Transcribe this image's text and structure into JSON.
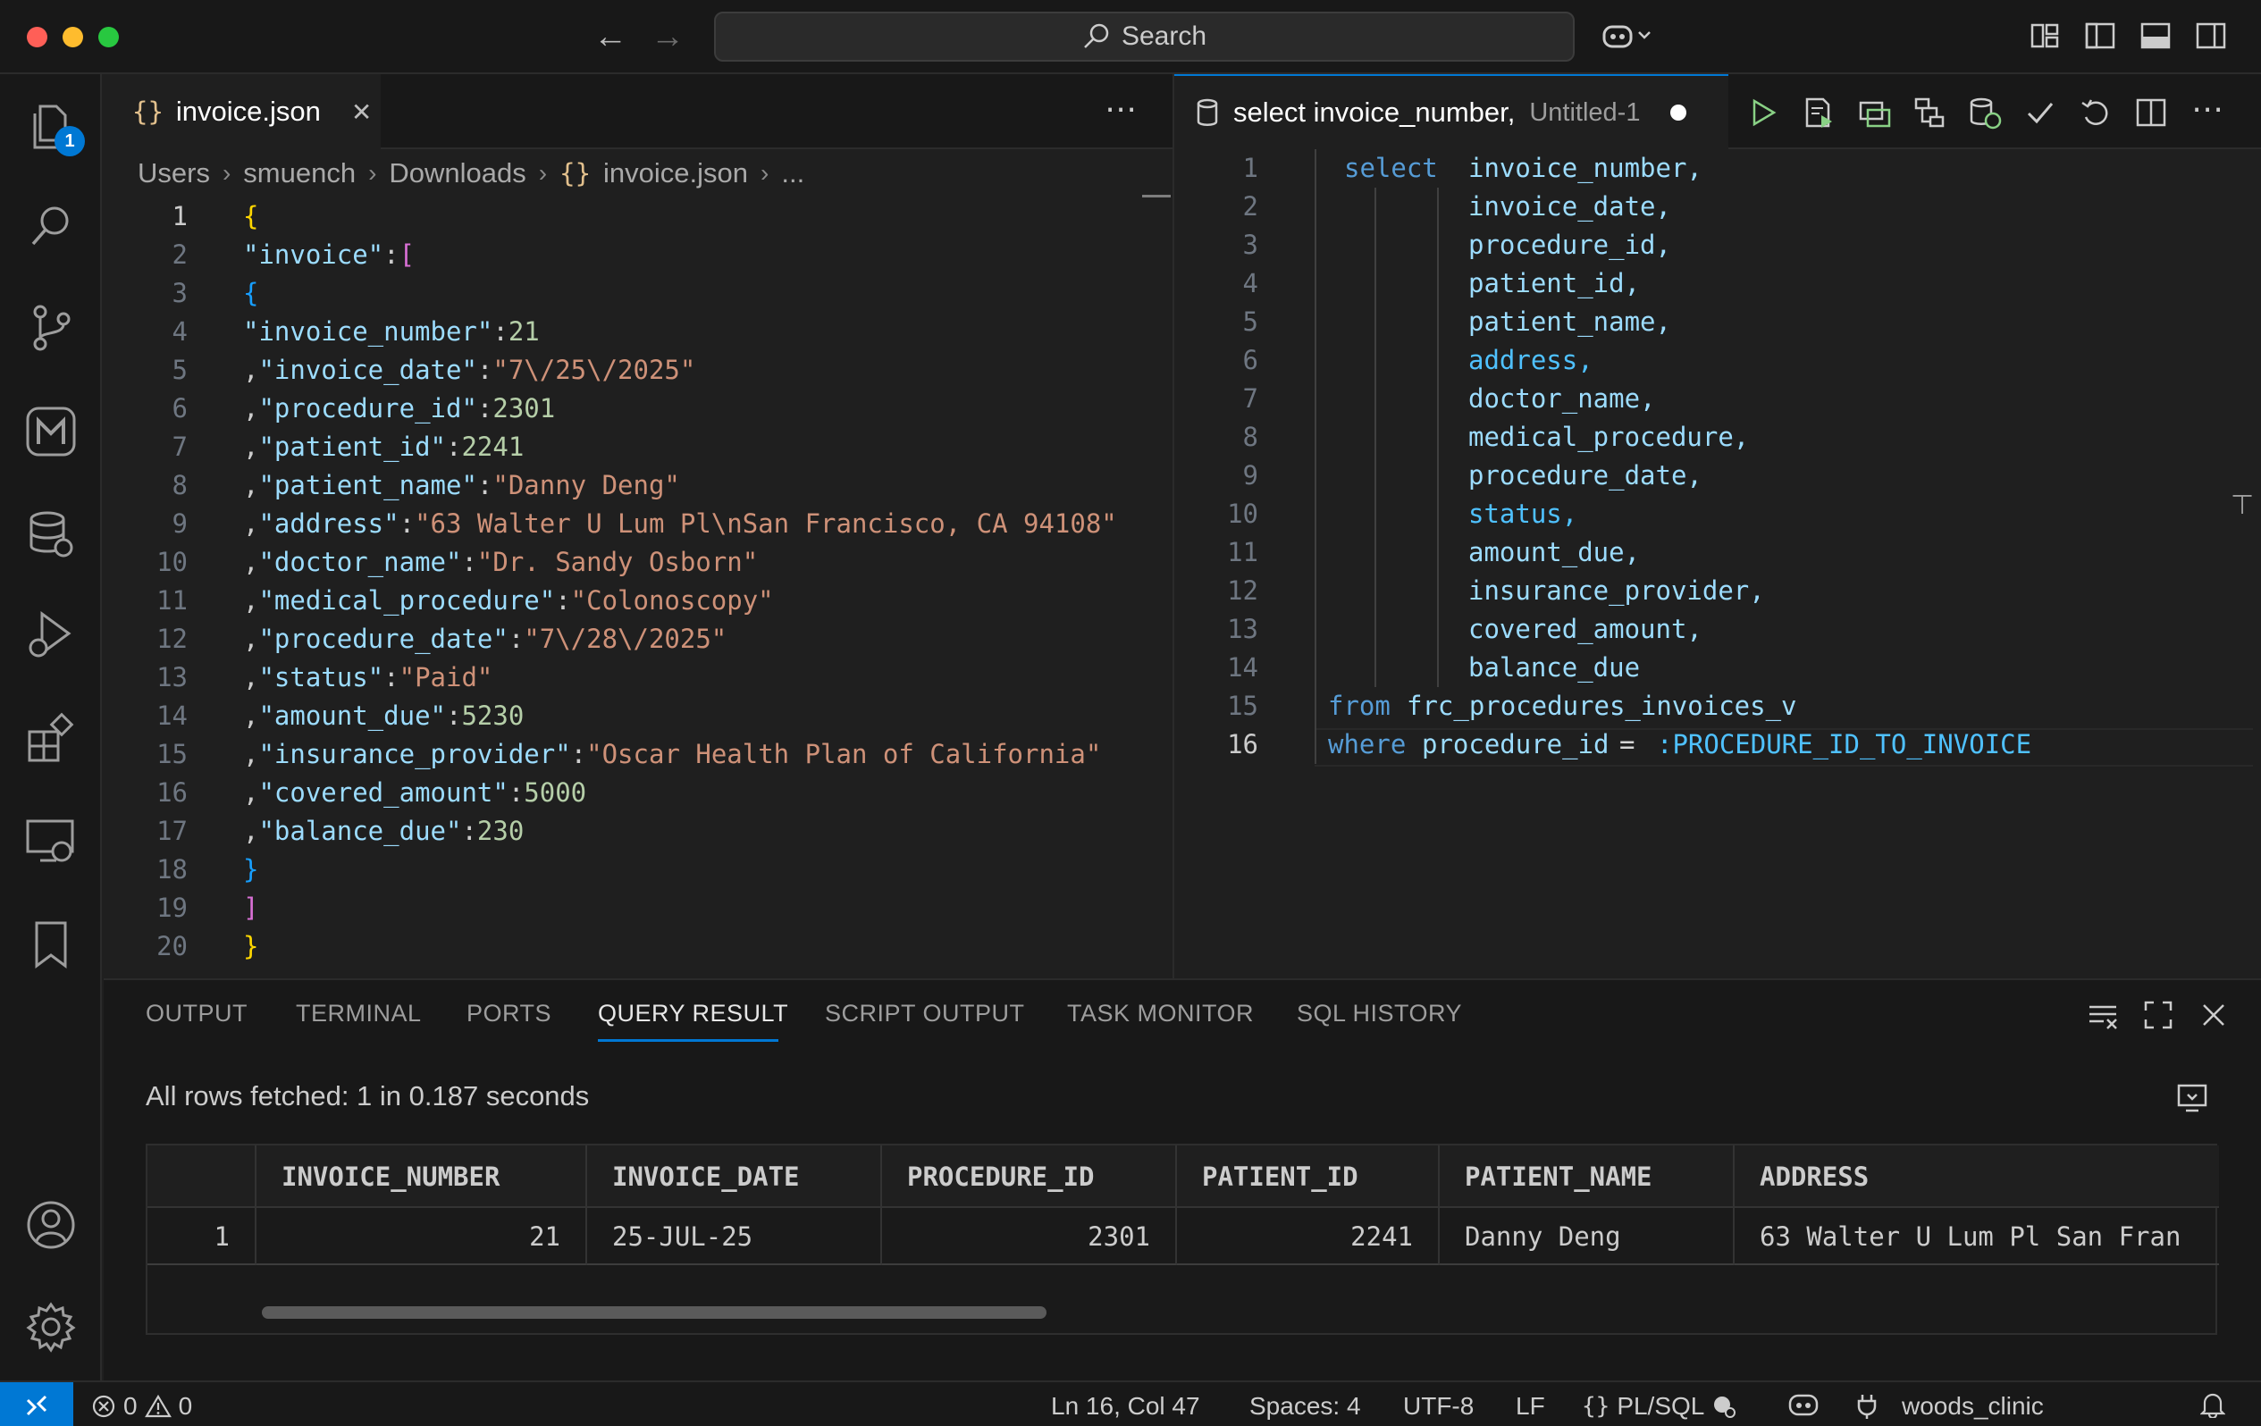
{
  "titlebar": {
    "search_label": "Search",
    "traffic_colors": [
      "#ff5f57",
      "#febc2e",
      "#28c840"
    ]
  },
  "activitybar": {
    "explorer_badge": "1",
    "icons": [
      "explorer-icon",
      "search-icon",
      "source-control-icon",
      "marketplace-m-icon",
      "database-icon",
      "run-debug-icon",
      "extensions-icon",
      "remote-explorer-icon",
      "bookmark-icon",
      "account-icon",
      "settings-gear-icon"
    ]
  },
  "left_editor": {
    "tab_label": "invoice.json",
    "breadcrumb": [
      "Users",
      "smuench",
      "Downloads",
      "invoice.json",
      "..."
    ],
    "line_numbers": [
      "1",
      "2",
      "3",
      "4",
      "5",
      "6",
      "7",
      "8",
      "9",
      "10",
      "11",
      "12",
      "13",
      "14",
      "15",
      "16",
      "17",
      "18",
      "19",
      "20"
    ],
    "json_lines": [
      {
        "open": "{"
      },
      {
        "key": "\"invoice\"",
        "open": "["
      },
      {
        "open": "{"
      },
      {
        "prefix": "",
        "key": "\"invoice_number\"",
        "num": "21"
      },
      {
        "prefix": ",",
        "key": "\"invoice_date\"",
        "str": "\"7\\/25\\/2025\""
      },
      {
        "prefix": ",",
        "key": "\"procedure_id\"",
        "num": "2301"
      },
      {
        "prefix": ",",
        "key": "\"patient_id\"",
        "num": "2241"
      },
      {
        "prefix": ",",
        "key": "\"patient_name\"",
        "str": "\"Danny Deng\""
      },
      {
        "prefix": ",",
        "key": "\"address\"",
        "str": "\"63 Walter U Lum Pl\\nSan Francisco, CA 94108\""
      },
      {
        "prefix": ",",
        "key": "\"doctor_name\"",
        "str": "\"Dr. Sandy Osborn\""
      },
      {
        "prefix": ",",
        "key": "\"medical_procedure\"",
        "str": "\"Colonoscopy\""
      },
      {
        "prefix": ",",
        "key": "\"procedure_date\"",
        "str": "\"7\\/28\\/2025\""
      },
      {
        "prefix": ",",
        "key": "\"status\"",
        "str": "\"Paid\""
      },
      {
        "prefix": ",",
        "key": "\"amount_due\"",
        "num": "5230"
      },
      {
        "prefix": ",",
        "key": "\"insurance_provider\"",
        "str": "\"Oscar Health Plan of California\""
      },
      {
        "prefix": ",",
        "key": "\"covered_amount\"",
        "num": "5000"
      },
      {
        "prefix": ",",
        "key": "\"balance_due\"",
        "num": "230"
      },
      {
        "close": "}"
      },
      {
        "close": "]"
      },
      {
        "close": "}"
      }
    ]
  },
  "right_editor": {
    "tab_title": "select invoice_number,",
    "tab_desc": "Untitled-1",
    "line_numbers": [
      "1",
      "2",
      "3",
      "4",
      "5",
      "6",
      "7",
      "8",
      "9",
      "10",
      "11",
      "12",
      "13",
      "14",
      "15",
      "16"
    ],
    "sql": {
      "select_kw": "select",
      "columns": [
        "invoice_number,",
        "invoice_date,",
        "procedure_id,",
        "patient_id,",
        "patient_name,",
        "address,",
        "doctor_name,",
        "medical_procedure,",
        "procedure_date,",
        "status,",
        "amount_due,",
        "insurance_provider,",
        "covered_amount,",
        "balance_due"
      ],
      "from_kw": "from",
      "table": "frc_procedures_invoices_v",
      "where_kw": "where",
      "where_col": "procedure_id",
      "op": "=",
      "bind": ":PROCEDURE_ID_TO_INVOICE"
    }
  },
  "panel": {
    "tabs": [
      "OUTPUT",
      "TERMINAL",
      "PORTS",
      "QUERY RESULT",
      "SCRIPT OUTPUT",
      "TASK MONITOR",
      "SQL HISTORY"
    ],
    "active_tab": "QUERY RESULT",
    "status": "All rows fetched: 1 in 0.187 seconds",
    "grid": {
      "columns": [
        "INVOICE_NUMBER",
        "INVOICE_DATE",
        "PROCEDURE_ID",
        "PATIENT_ID",
        "PATIENT_NAME",
        "ADDRESS"
      ],
      "rows": [
        {
          "row_num": "1",
          "cells": [
            "21",
            "25-JUL-25",
            "2301",
            "2241",
            "Danny Deng",
            "63 Walter U Lum Pl San Fran"
          ]
        }
      ]
    }
  },
  "statusbar": {
    "errors": "0",
    "warnings": "0",
    "cursor": "Ln 16, Col 47",
    "spaces": "Spaces: 4",
    "encoding": "UTF-8",
    "eol": "LF",
    "language": "PL/SQL",
    "connection": "woods_clinic",
    "accent_color": "#0078d4"
  }
}
